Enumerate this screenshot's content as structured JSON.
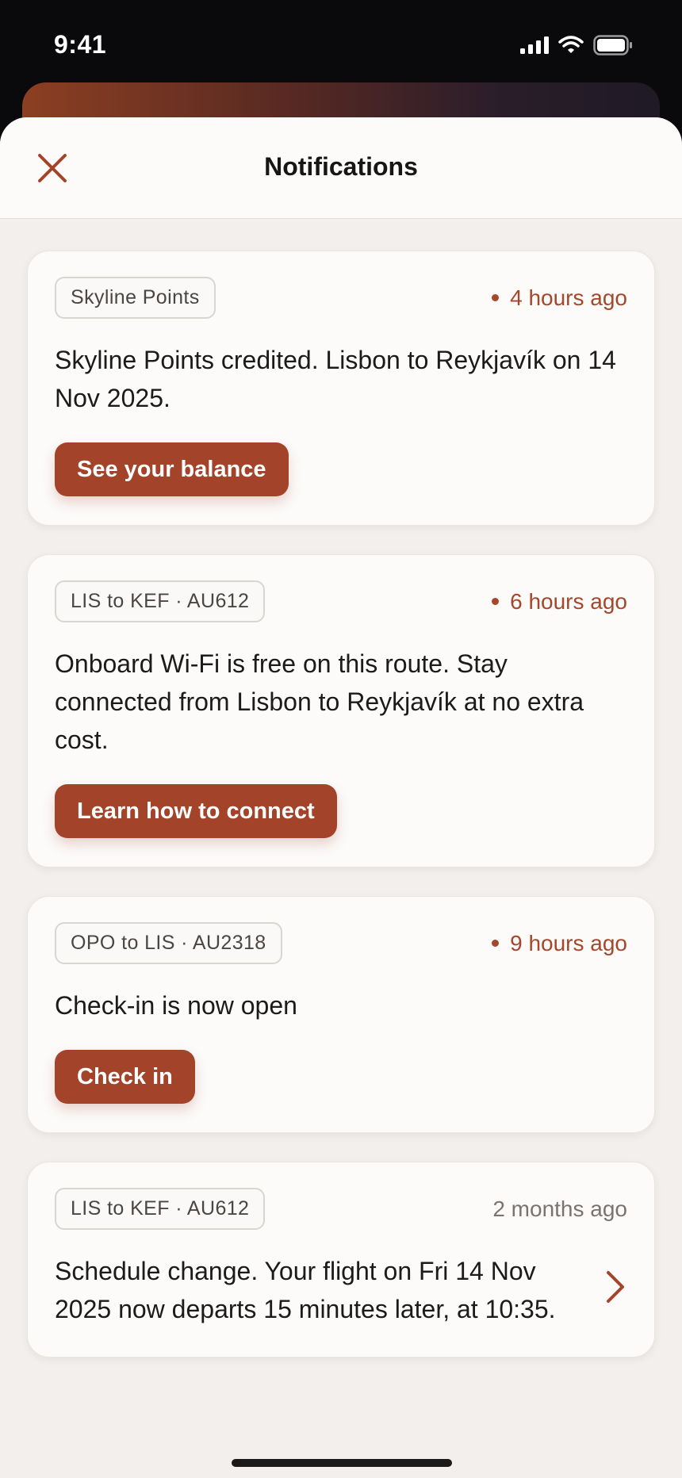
{
  "status_bar": {
    "time": "9:41"
  },
  "header": {
    "title": "Notifications"
  },
  "colors": {
    "accent": "#a3442a",
    "sheet_bg": "#f2efec",
    "card_bg": "#fcfbfa"
  },
  "icons": {
    "close": "close-icon",
    "signal": "signal-icon",
    "wifi": "wifi-icon",
    "battery": "battery-icon",
    "chevron": "chevron-right-icon"
  },
  "notifications": [
    {
      "tag": "Skyline Points",
      "time": "4 hours ago",
      "unread": true,
      "message": "Skyline Points credited. Lisbon to Reykjavík on 14 Nov 2025.",
      "cta": "See your balance"
    },
    {
      "tag": "LIS to KEF · AU612",
      "time": "6 hours ago",
      "unread": true,
      "message": "Onboard Wi-Fi is free on this route. Stay connected from Lisbon to Reykjavík at no extra cost.",
      "cta": "Learn how to connect"
    },
    {
      "tag": "OPO to LIS · AU2318",
      "time": "9 hours ago",
      "unread": true,
      "message": "Check-in is now open",
      "cta": "Check in"
    },
    {
      "tag": "LIS to KEF · AU612",
      "time": "2 months ago",
      "unread": false,
      "message": "Schedule change. Your flight on Fri 14 Nov 2025 now departs 15 minutes later, at 10:35."
    }
  ]
}
